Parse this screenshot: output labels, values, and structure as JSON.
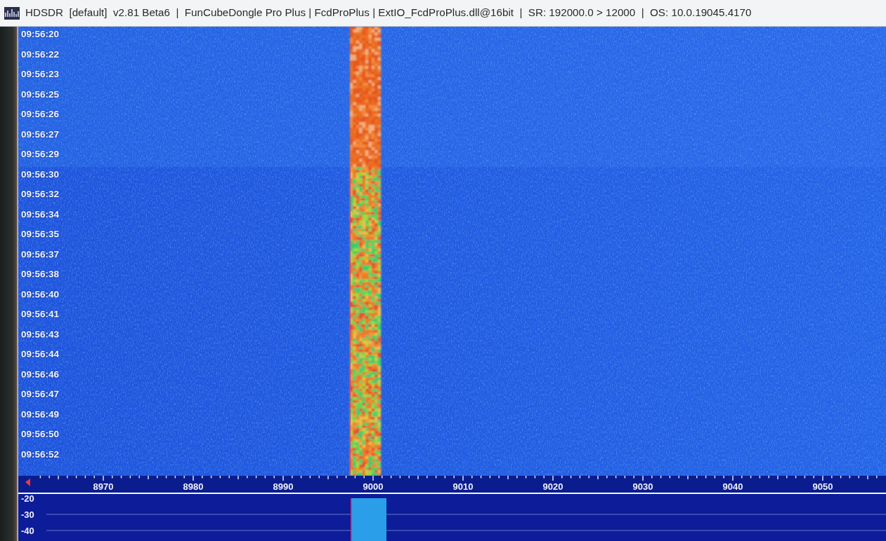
{
  "window": {
    "title": "HDSDR  [default]  v2.81 Beta6  |  FunCubeDongle Pro Plus | FcdProPlus | ExtIO_FcdProPlus.dll@16bit  |  SR: 192000.0 > 12000  |  OS: 10.0.19045.4170"
  },
  "waterfall": {
    "timestamps": [
      "09:56:20",
      "09:56:22",
      "09:56:23",
      "09:56:25",
      "09:56:26",
      "09:56:27",
      "09:56:29",
      "09:56:30",
      "09:56:32",
      "09:56:34",
      "09:56:35",
      "09:56:37",
      "09:56:38",
      "09:56:40",
      "09:56:41",
      "09:56:43",
      "09:56:44",
      "09:56:46",
      "09:56:47",
      "09:56:49",
      "09:56:50",
      "09:56:52"
    ]
  },
  "frequency_scale": {
    "labels": [
      "8970",
      "8980",
      "8990",
      "9000",
      "9010",
      "9020",
      "9030",
      "9040",
      "9050"
    ]
  },
  "spectrum": {
    "db_labels": [
      "-20",
      "-30",
      "-40"
    ]
  }
}
